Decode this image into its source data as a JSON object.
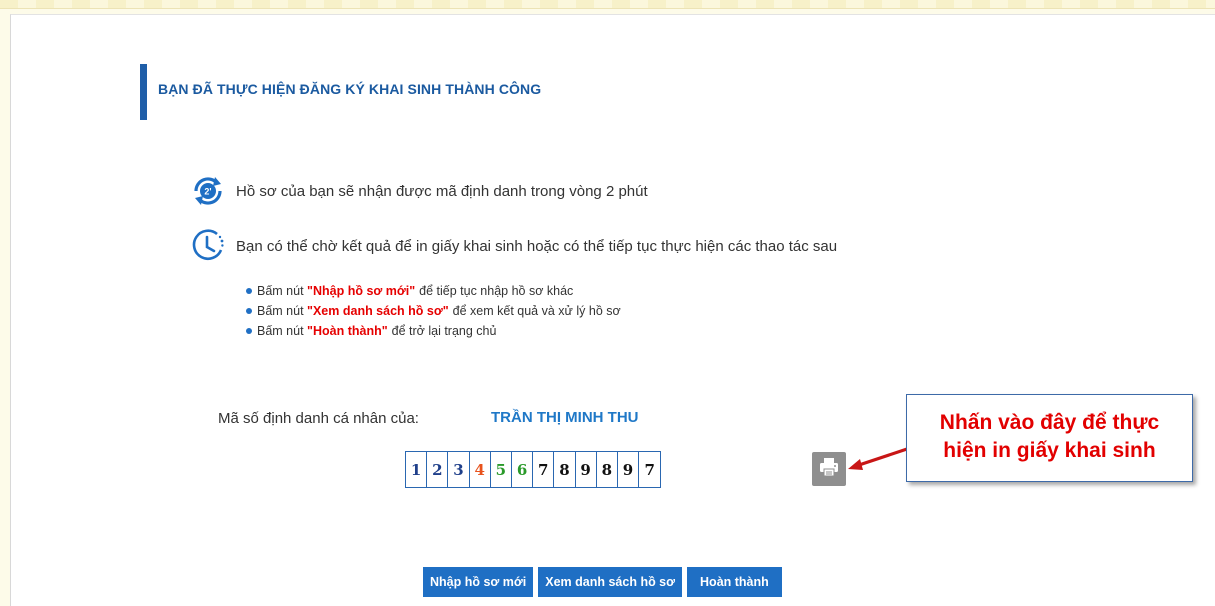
{
  "page": {
    "title": "BẠN ĐÃ THỰC HIỆN ĐĂNG KÝ KHAI SINH THÀNH CÔNG"
  },
  "info": [
    {
      "icon": "2-minute-refresh-icon",
      "badge": "2'",
      "text": "Hồ sơ của bạn sẽ nhận được mã định danh trong vòng 2 phút"
    },
    {
      "icon": "clock-icon",
      "text": "Bạn có thể chờ kết quả để in giấy khai sinh hoặc có thể tiếp tục thực hiện các thao tác sau"
    }
  ],
  "steps": [
    {
      "prefix": "Bấm nút",
      "highlight": "\"Nhập hồ sơ mới\"",
      "suffix": "để tiếp tục nhập hồ sơ khác"
    },
    {
      "prefix": "Bấm nút",
      "highlight": "\"Xem danh sách hồ sơ\"",
      "suffix": "để xem kết quả và xử lý hồ sơ"
    },
    {
      "prefix": "Bấm nút",
      "highlight": "\"Hoàn thành\"",
      "suffix": "để trở lại trạng chủ"
    }
  ],
  "identity": {
    "label": "Mã số định danh cá nhân của:",
    "name": "TRẦN THỊ MINH THU",
    "digits": [
      {
        "value": "1",
        "color": "#1f3f8a"
      },
      {
        "value": "2",
        "color": "#1f3f8a"
      },
      {
        "value": "3",
        "color": "#1f3f8a"
      },
      {
        "value": "4",
        "color": "#e8531d"
      },
      {
        "value": "5",
        "color": "#2a9a2a"
      },
      {
        "value": "6",
        "color": "#2a9a2a"
      },
      {
        "value": "7",
        "color": "#111111"
      },
      {
        "value": "8",
        "color": "#111111"
      },
      {
        "value": "9",
        "color": "#111111"
      },
      {
        "value": "8",
        "color": "#111111"
      },
      {
        "value": "9",
        "color": "#111111"
      },
      {
        "value": "7",
        "color": "#111111"
      }
    ],
    "print_icon": "printer-icon"
  },
  "callout": {
    "line1": "Nhấn vào đây để thực",
    "line2": "hiện in giấy khai sinh"
  },
  "actions": {
    "new_record": "Nhập hồ sơ mới",
    "view_list": "Xem danh sách hồ sơ",
    "finish": "Hoàn thành"
  },
  "colors": {
    "accent": "#1f6fc4",
    "title": "#1b5aa0",
    "highlight": "#e60000"
  }
}
